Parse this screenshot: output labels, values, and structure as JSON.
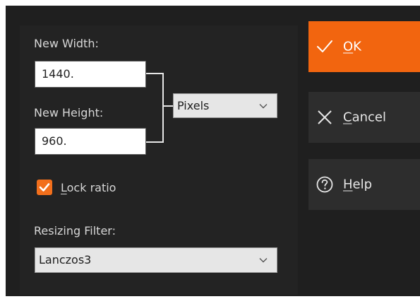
{
  "dialog": {
    "new_width_label": "New Width:",
    "new_width_value": "1440.",
    "new_height_label": "New Height:",
    "new_height_value": "960.",
    "unit_select": {
      "selected": "Pixels"
    },
    "lock_ratio": {
      "label_first": "L",
      "label_rest": "ock ratio",
      "checked": true
    },
    "resizing_filter_label": "Resizing Filter:",
    "filter_select": {
      "selected": "Lanczos3"
    }
  },
  "buttons": {
    "ok": {
      "mnemonic": "O",
      "rest": "K",
      "icon": "check-icon"
    },
    "cancel": {
      "mnemonic": "C",
      "rest": "ancel",
      "icon": "close-icon"
    },
    "help": {
      "mnemonic": "H",
      "rest": "elp",
      "icon": "help-circle-icon"
    }
  },
  "colors": {
    "accent": "#f2650f",
    "dialog_background": "#1f1f1f",
    "button_background": "#2d2d2d",
    "text": "#d7d7d7"
  }
}
